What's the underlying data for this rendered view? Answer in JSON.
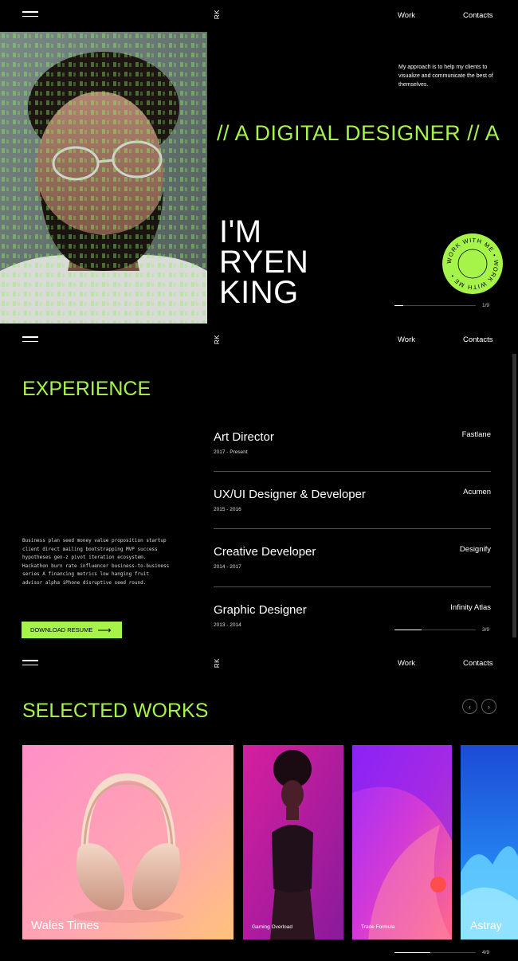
{
  "nav": {
    "logo": "RK",
    "work": "Work",
    "contacts": "Contacts"
  },
  "hero": {
    "approach": "My approach is to help my clients to visualize and communicate the best of themselves.",
    "marquee": "// A DIGITAL DESIGNER // A",
    "name_line1": "I'M",
    "name_line2": "RYEN",
    "name_line3": "KING",
    "badge_text": "WORK WITH ME • WORK WITH ME •",
    "pager": "1/9",
    "pager_progress": 0.11
  },
  "experience": {
    "heading": "EXPERIENCE",
    "bio": "Business plan seed money value proposition startup client direct mailing bootstrapping MVP success hypotheses gen-z pivot iteration ecosystem. Hackathon burn rate influencer business-to-business series A financing metrics low hanging fruit advisor alpha iPhone disruptive seed round.",
    "download_label": "DOWNLOAD RESUME",
    "pager": "3/9",
    "pager_progress": 0.33,
    "items": [
      {
        "title": "Art Director",
        "date": "2017 - Present",
        "company": "Fastlane"
      },
      {
        "title": "UX/UI Designer & Developer",
        "date": "2015 - 2016",
        "company": "Acumen"
      },
      {
        "title": "Creative Developer",
        "date": "2014 - 2017",
        "company": "Designify"
      },
      {
        "title": "Graphic Designer",
        "date": "2013 - 2014",
        "company": "Infinity Atlas"
      }
    ]
  },
  "works": {
    "heading": "SELECTED WORKS",
    "pager": "4/9",
    "pager_progress": 0.44,
    "cards": [
      {
        "label": "Wales Times"
      },
      {
        "label": "Gaming Overload"
      },
      {
        "label": "Trade Formula"
      },
      {
        "label": "Astray"
      }
    ]
  },
  "colors": {
    "accent": "#a6f34a",
    "background": "#000000"
  },
  "icons": {
    "menu": "hamburger-icon",
    "arrow": "arrow-right-icon",
    "prev": "chevron-left-icon",
    "next": "chevron-right-icon"
  }
}
